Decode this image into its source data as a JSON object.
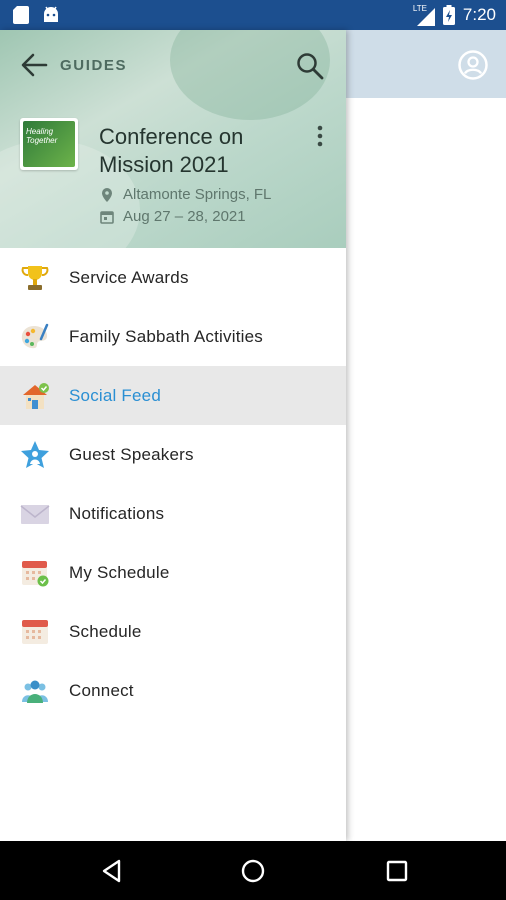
{
  "status_bar": {
    "time": "7:20",
    "network": "LTE",
    "icons": [
      "sd-card-icon",
      "android-icon",
      "signal-icon",
      "battery-icon"
    ]
  },
  "drawer": {
    "header": {
      "back_icon": "arrow-back-icon",
      "section_label": "GUIDES",
      "search_icon": "search-icon",
      "event_logo_text": "Healing Together",
      "event_title": "Conference on Mission 2021",
      "location": "Altamonte Springs, FL",
      "dates": "Aug 27 – 28, 2021",
      "more_icon": "more-vert-icon"
    },
    "menu_items": [
      {
        "label": "Service Awards",
        "icon": "trophy-icon",
        "active": false
      },
      {
        "label": "Family Sabbath Activities",
        "icon": "palette-icon",
        "active": false
      },
      {
        "label": "Social Feed",
        "icon": "home-social-icon",
        "active": true
      },
      {
        "label": "Guest Speakers",
        "icon": "star-person-icon",
        "active": false
      },
      {
        "label": "Notifications",
        "icon": "envelope-icon",
        "active": false
      },
      {
        "label": "My Schedule",
        "icon": "calendar-check-icon",
        "active": false
      },
      {
        "label": "Schedule",
        "icon": "calendar-icon",
        "active": false
      },
      {
        "label": "Connect",
        "icon": "people-icon",
        "active": false
      }
    ]
  },
  "app_bar": {
    "profile_icon": "account-circle-icon"
  },
  "colors": {
    "status_bar": "#1c4f8f",
    "app_bar": "#cfdde8",
    "active_item_text": "#2a8fd3",
    "active_item_bg": "#e8e8e8"
  },
  "nav_bar": {
    "buttons": [
      "back-nav-icon",
      "home-nav-icon",
      "recents-nav-icon"
    ]
  }
}
